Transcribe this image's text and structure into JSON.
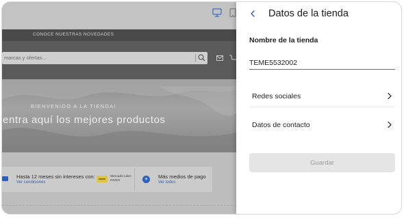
{
  "preview": {
    "device_icons": [
      "desktop-icon",
      "tablet-icon"
    ],
    "announcement": "CONOCE NUESTRAS NOVEDADES",
    "search_placeholder": "marcas y ofertas...",
    "hero_welcome": "BIENVENIDO A LA TIENDA!",
    "hero_title": "entra aquí los mejores productos",
    "benefits": [
      {
        "title": "Hasta 12 meses sin intereses con:",
        "link": "Ver condiciones",
        "icon": "card-icon"
      },
      {
        "title": "Mercado Libre",
        "subtitle": "INVEX",
        "icon": "mercado-pago-logo"
      },
      {
        "title": "Más medios de pago",
        "link": "Ver todos",
        "icon": "plus-icon"
      }
    ]
  },
  "panel": {
    "title": "Datos de la tienda",
    "back_icon": "chevron-left-icon",
    "store_name_label": "Nombre de la tienda",
    "store_name_value": "TEME5532002",
    "nav_items": [
      {
        "label": "Redes sociales",
        "icon": "chevron-right-icon"
      },
      {
        "label": "Datos de contacto",
        "icon": "chevron-right-icon"
      }
    ],
    "save_label": "Guardar"
  },
  "colors": {
    "accent": "#2f5fb3",
    "overlay": "#bdbdbd",
    "panel_bg": "#ffffff",
    "button_disabled_bg": "#e5e5e5",
    "button_disabled_text": "#9c9c9c"
  }
}
